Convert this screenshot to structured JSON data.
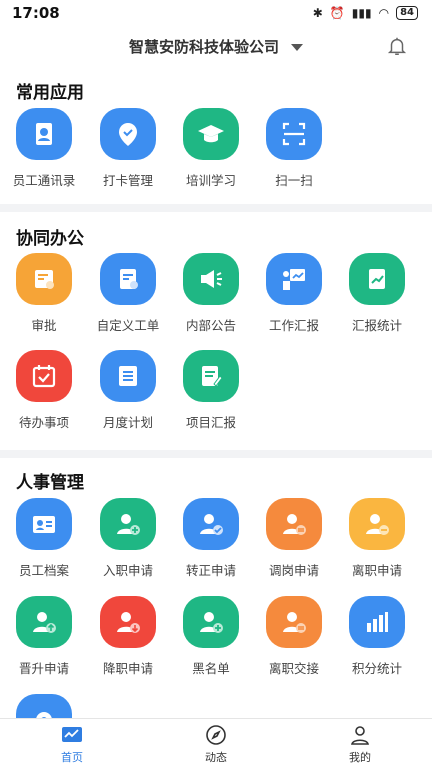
{
  "status": {
    "time": "17:08",
    "battery": "84"
  },
  "header": {
    "company": "智慧安防科技体验公司"
  },
  "sections": {
    "common": {
      "title": "常用应用",
      "items": [
        "员工通讯录",
        "打卡管理",
        "培训学习",
        "扫一扫"
      ]
    },
    "office": {
      "title": "协同办公",
      "items": [
        "审批",
        "自定义工单",
        "内部公告",
        "工作汇报",
        "汇报统计",
        "待办事项",
        "月度计划",
        "项目汇报"
      ]
    },
    "hr": {
      "title": "人事管理",
      "items": [
        "员工档案",
        "入职申请",
        "转正申请",
        "调岗申请",
        "离职申请",
        "晋升申请",
        "降职申请",
        "黑名单",
        "离职交接",
        "积分统计"
      ]
    }
  },
  "tabs": [
    "首页",
    "动态",
    "我的"
  ],
  "colors": {
    "accent": "#2f7de1",
    "blue": "#3d8ef0",
    "green": "#1fb784",
    "orange": "#f6a437",
    "red": "#f0473c"
  }
}
